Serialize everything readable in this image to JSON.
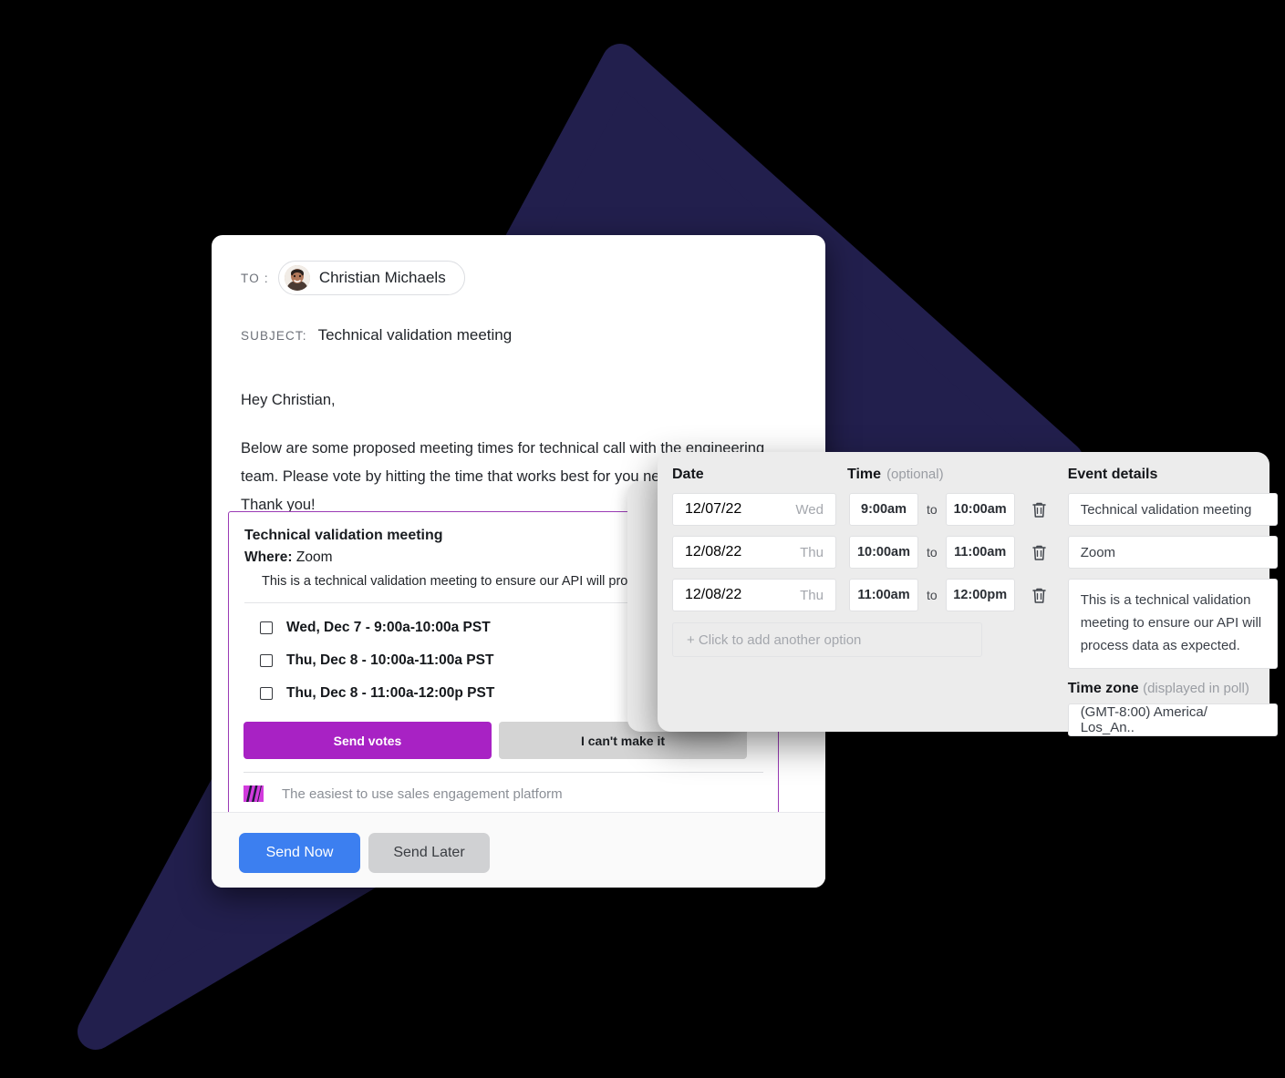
{
  "background": {
    "page_color": "#000000",
    "shape_color": "#221f4d",
    "shape_name": "triangle"
  },
  "email": {
    "to_label": "TO :",
    "recipient": "Christian Michaels",
    "avatar_name": "user-avatar",
    "subject_label": "SUBJECT:",
    "subject_value": "Technical validation meeting",
    "greeting": "Hey Christian,",
    "body_line_1": "Below are some proposed meeting times for technical call with the engineering",
    "body_line_2": "team.  Please vote by hitting the time that works best for you next",
    "body_line_3": "Thank you!",
    "send_now": "Send Now",
    "send_later": "Send Later",
    "send_now_color": "#3c7ff0",
    "send_later_color": "#d0d1d3"
  },
  "poll": {
    "title": "Technical validation meeting",
    "where_label": "Where:",
    "where_value": "Zoom",
    "description": "This is a technical validation meeting to ensure our API will process data as expected.",
    "options": [
      "Wed, Dec 7 - 9:00a-10:00a PST",
      "Thu, Dec 8 - 10:00a-11:00a PST",
      "Thu, Dec 8 - 11:00a-12:00p PST"
    ],
    "send_votes": "Send votes",
    "cant_make_it": "I can't make it",
    "footer_text": "The easiest to use sales engagement platform",
    "accent_color": "#a822c4",
    "border_color": "#9a3bb5"
  },
  "scheduler": {
    "date_header": "Date",
    "time_header": "Time",
    "time_header_note": "(optional)",
    "to_word": "to",
    "slots": [
      {
        "date": "12/07/22",
        "dow": "Wed",
        "start": "9:00am",
        "end": "10:00am"
      },
      {
        "date": "12/08/22",
        "dow": "Thu",
        "start": "10:00am",
        "end": "11:00am"
      },
      {
        "date": "12/08/22",
        "dow": "Thu",
        "start": "11:00am",
        "end": "12:00pm"
      }
    ],
    "add_option": "+ Click to add another option",
    "details_header": "Event details",
    "detail_title": "Technical validation meeting",
    "detail_location": "Zoom",
    "detail_description": "This is a technical validation meeting to ensure our API will process data as expected.",
    "timezone_label": "Time zone",
    "timezone_note": "(displayed in poll)",
    "timezone_value": "(GMT-8:00) America/ Los_An.."
  }
}
